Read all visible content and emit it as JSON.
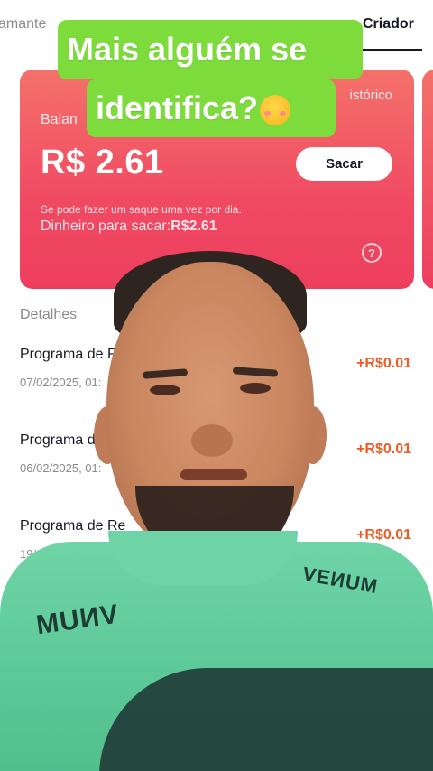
{
  "tabs": [
    {
      "label": "amante",
      "active": false
    },
    {
      "label": "Criador",
      "active": true
    }
  ],
  "card": {
    "balance_label": "Balan",
    "history_link": "istórico",
    "amount": "R$ 2.61",
    "withdraw_label": "Sacar",
    "note": "Se pode fazer um saque uma vez por dia.",
    "available_label": "Dinheiro para sacar:",
    "available_value": "R$2.61",
    "help_icon": "?",
    "colors": {
      "gradient_top": "#f4716a",
      "gradient_bottom": "#ee3e5e"
    }
  },
  "details": {
    "title": "Detalhes",
    "rows": [
      {
        "title": "Programa de R",
        "date": "07/02/2025, 01:",
        "amount": "+R$0.01"
      },
      {
        "title": "Programa d",
        "date": "06/02/2025, 01:",
        "amount": "+R$0.01"
      },
      {
        "title": "Programa de Re",
        "date": "19/01/20",
        "amount": "+R$0.01"
      }
    ]
  },
  "caption": {
    "line1": "Mais alguém se",
    "line2": "identifica?",
    "emoji": "woozy-face-icon",
    "bg_color": "#7ddc3c"
  },
  "shirt": {
    "text_left": "MUИV",
    "text_right": "VEИUM"
  }
}
